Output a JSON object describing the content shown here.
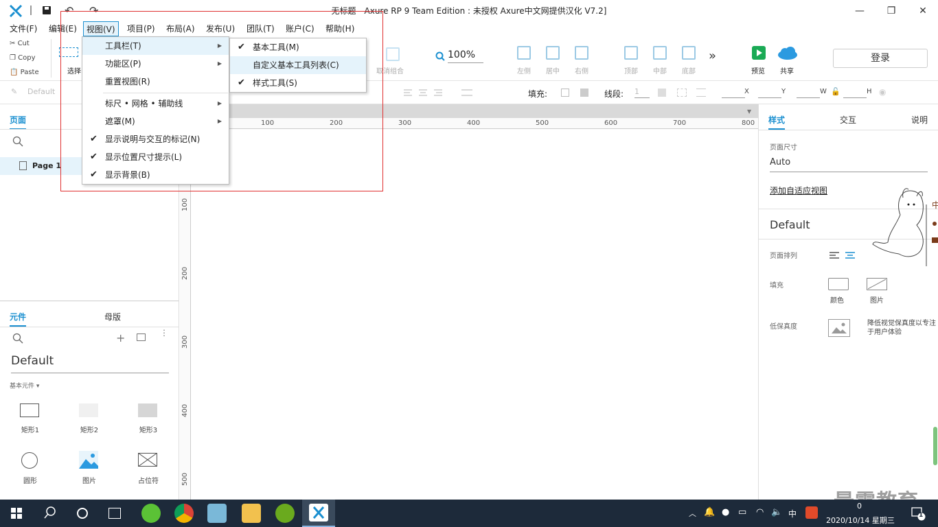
{
  "window": {
    "title": "无标题 - Axure RP 9 Team Edition : 未授权    Axure中文网提供汉化 V7.2]",
    "min_glyph": "—",
    "max_glyph": "❐",
    "close_glyph": "✕"
  },
  "menubar": {
    "items": [
      "文件(F)",
      "编辑(E)",
      "视图(V)",
      "项目(P)",
      "布局(A)",
      "发布(U)",
      "团队(T)",
      "账户(C)",
      "帮助(H)"
    ]
  },
  "clipboard": {
    "cut": "Cut",
    "copy": "Copy",
    "paste": "Paste"
  },
  "toolbar": {
    "select_label": "选择",
    "ungroup_label": "取消组合",
    "zoom": "100%",
    "align": [
      "左侧",
      "居中",
      "右侧",
      "顶部",
      "中部",
      "底部"
    ],
    "more": "»",
    "preview": "预览",
    "share": "共享",
    "login": "登录"
  },
  "stylebar": {
    "style_name": "Default",
    "fill_label": "填充:",
    "stroke_label": "线段:",
    "stroke_value": "1",
    "x_label": "X",
    "y_label": "Y",
    "w_label": "W",
    "h_label": "H"
  },
  "left": {
    "pages_tab": "页面",
    "page1": "Page 1",
    "widgets_tab": "元件",
    "masters_tab": "母版",
    "library": "Default",
    "category": "基本元件 ▾",
    "widgets": [
      "矩形1",
      "矩形2",
      "矩形3",
      "圆形",
      "图片",
      "占位符"
    ]
  },
  "ruler": {
    "h": [
      "100",
      "200",
      "300",
      "400",
      "500",
      "600",
      "700",
      "800"
    ],
    "v": [
      "100",
      "200",
      "300",
      "400",
      "500"
    ]
  },
  "view_menu": {
    "items": [
      {
        "label": "工具栏(T)",
        "check": "",
        "arrow": "▶"
      },
      {
        "label": "功能区(P)",
        "check": "",
        "arrow": "▶"
      },
      {
        "label": "重置视图(R)",
        "check": "",
        "arrow": ""
      },
      {
        "label": "标尺 • 网格 • 辅助线",
        "check": "",
        "arrow": "▶"
      },
      {
        "label": "遮罩(M)",
        "check": "",
        "arrow": "▶"
      },
      {
        "label": "显示说明与交互的标记(N)",
        "check": "✔",
        "arrow": ""
      },
      {
        "label": "显示位置尺寸提示(L)",
        "check": "✔",
        "arrow": ""
      },
      {
        "label": "显示背景(B)",
        "check": "✔",
        "arrow": ""
      }
    ]
  },
  "toolbar_submenu": {
    "items": [
      {
        "label": "基本工具(M)",
        "check": "✔"
      },
      {
        "label": "自定义基本工具列表(C)",
        "check": ""
      },
      {
        "label": "样式工具(S)",
        "check": "✔"
      }
    ]
  },
  "right": {
    "tabs": [
      "样式",
      "交互",
      "说明"
    ],
    "page_size_label": "页面尺寸",
    "page_size": "Auto",
    "adaptive_link": "添加自适应视图",
    "style_name": "Default",
    "page_align_label": "页面排列",
    "fill_label": "填充",
    "fill_color": "颜色",
    "fill_image": "图片",
    "lowfi_label": "低保真度",
    "lowfi_desc": "降低视觉保真度以专注于用户体验",
    "deco_char": "中"
  },
  "watermark": "最需教育",
  "taskbar": {
    "ime": "中",
    "time": "0",
    "date": "2020/10/14 星期三",
    "notif_count": "1"
  },
  "colors": {
    "accent": "#1a8fd0",
    "highlight": "#e5f3fb",
    "taskbar": "#1d2a3a",
    "annotation": "#e03030"
  }
}
